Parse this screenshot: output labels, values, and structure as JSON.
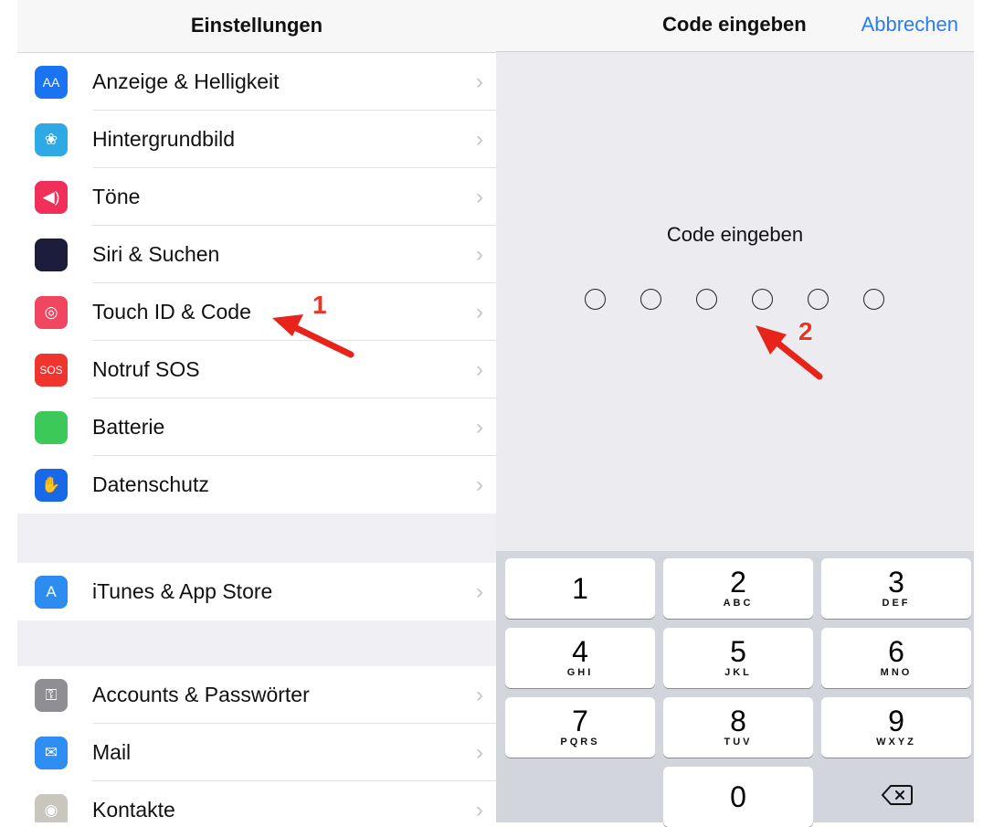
{
  "settings": {
    "title": "Einstellungen",
    "group1": [
      {
        "label": "Anzeige & Helligkeit",
        "icon": "display-icon",
        "color": "#1a73f0",
        "glyph": "AA"
      },
      {
        "label": "Hintergrundbild",
        "icon": "wallpaper-icon",
        "color": "#2fa8e6",
        "glyph": "❀"
      },
      {
        "label": "Töne",
        "icon": "sound-icon",
        "color": "#f0305a",
        "glyph": "◀)"
      },
      {
        "label": "Siri & Suchen",
        "icon": "siri-icon",
        "color": "#1c1c3c",
        "glyph": ""
      },
      {
        "label": "Touch ID & Code",
        "icon": "fingerprint-icon",
        "color": "#f04660",
        "glyph": "◎"
      },
      {
        "label": "Notruf SOS",
        "icon": "sos-icon",
        "color": "#f0342e",
        "glyph": "SOS"
      },
      {
        "label": "Batterie",
        "icon": "battery-icon",
        "color": "#3dc85a",
        "glyph": ""
      },
      {
        "label": "Datenschutz",
        "icon": "privacy-hand-icon",
        "color": "#1769e8",
        "glyph": "✋"
      }
    ],
    "group2": [
      {
        "label": "iTunes & App Store",
        "icon": "app-store-icon",
        "color": "#2d8cf0",
        "glyph": "A"
      }
    ],
    "group3": [
      {
        "label": "Accounts & Passwörter",
        "icon": "key-icon",
        "color": "#8e8e93",
        "glyph": "⚿"
      },
      {
        "label": "Mail",
        "icon": "mail-icon",
        "color": "#2f8ef2",
        "glyph": "✉"
      },
      {
        "label": "Kontakte",
        "icon": "contacts-icon",
        "color": "#c9c6c0",
        "glyph": "◉"
      }
    ]
  },
  "passcode": {
    "header_title": "Code eingeben",
    "cancel": "Abbrechen",
    "prompt": "Code eingeben",
    "digit_count": 6,
    "keys": [
      {
        "digit": "1",
        "letters": ""
      },
      {
        "digit": "2",
        "letters": "ABC"
      },
      {
        "digit": "3",
        "letters": "DEF"
      },
      {
        "digit": "4",
        "letters": "GHI"
      },
      {
        "digit": "5",
        "letters": "JKL"
      },
      {
        "digit": "6",
        "letters": "MNO"
      },
      {
        "digit": "7",
        "letters": "PQRS"
      },
      {
        "digit": "8",
        "letters": "TUV"
      },
      {
        "digit": "9",
        "letters": "WXYZ"
      },
      {
        "digit": "0",
        "letters": ""
      }
    ]
  },
  "callouts": {
    "first": "1",
    "second": "2",
    "color": "#e8231a"
  }
}
